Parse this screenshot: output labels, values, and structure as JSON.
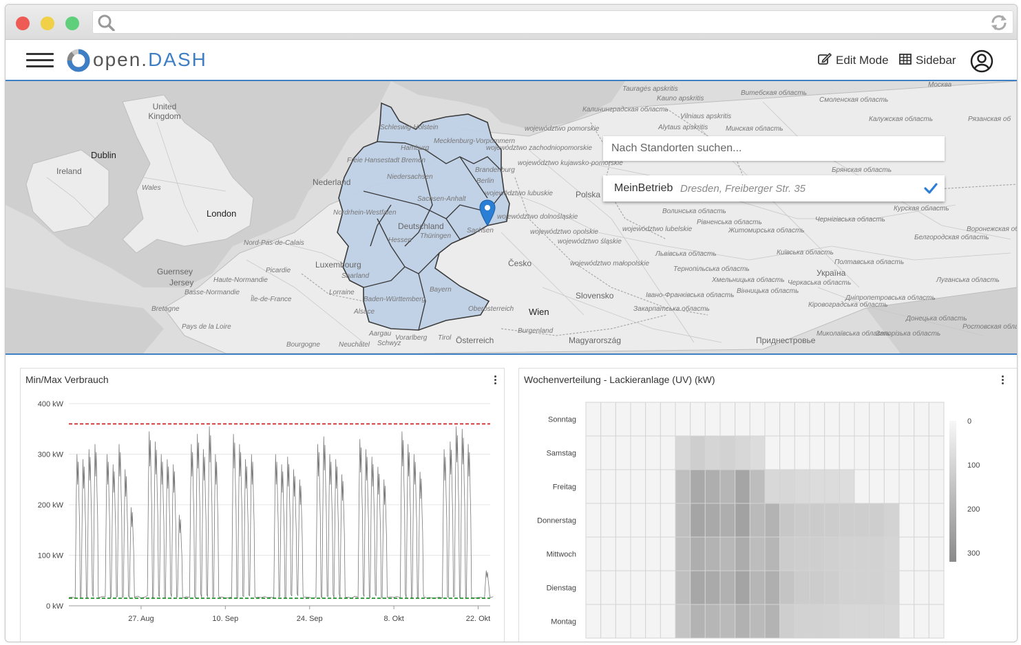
{
  "browser": {
    "search_icon": "search-icon",
    "reload_icon": "reload-icon"
  },
  "app": {
    "logo_text_main": "open.",
    "logo_text_accent": "DASH",
    "menu_icon": "hamburger-menu-icon",
    "edit_mode_label": "Edit Mode",
    "sidebar_label": "Sidebar",
    "user_icon": "user-account-icon",
    "accent_color": "#3d7ec4"
  },
  "map": {
    "search_placeholder": "Nach Standorten suchen...",
    "result": {
      "name": "MeinBetrieb",
      "address": "Dresden, Freiberger Str. 35",
      "selected": true
    },
    "labels": {
      "dublin": "Dublin",
      "ireland": "Ireland",
      "uk": "United Kingdom",
      "wales": "Wales",
      "london": "London",
      "nederland": "Nederland",
      "luxembourg": "Luxembourg",
      "nord_pas": "Nord-Pas-de-Calais",
      "picardie": "Picardie",
      "guernsey": "Guernsey",
      "jersey": "Jersey",
      "haute_normandie": "Haute-Normandie",
      "basse_normandie": "Basse-Normandie",
      "ile_de_france": "Île-de-France",
      "bretagne": "Bretagne",
      "pays_de_la_loire": "Pays de la Loire",
      "lorraine": "Lorraine",
      "alsace": "Alsace",
      "bourgogne": "Bourgogne",
      "neuchatel": "Neuchâtel",
      "schwyz": "Schwyz",
      "aargau": "Aargau",
      "vorarlberg": "Vorarlberg",
      "tirol": "Tirol",
      "oesterreich": "Österreich",
      "oberoesterreich": "Oberösterreich",
      "wien": "Wien",
      "burgenland": "Burgenland",
      "cesko": "Česko",
      "slovensko": "Slovensko",
      "magyarorszag": "Magyarország",
      "polska": "Polska",
      "sh": "Schleswig-Holstein",
      "mv": "Mecklenburg-Vorpommern",
      "hamburg": "Hamburg",
      "bremen": "Freie Hansestadt Bremen",
      "niedersachsen": "Niedersachsen",
      "brandenburg": "Brandenburg",
      "berlin": "Berlin",
      "sachsen_anhalt": "Sachsen-Anhalt",
      "nrw": "Nordrhein-Westfalen",
      "deutschland": "Deutschland",
      "hessen": "Hessen",
      "thueringen": "Thüringen",
      "sachsen": "Sachsen",
      "saarland": "Saarland",
      "bw": "Baden-Württemberg",
      "bayern": "Bayern",
      "pomorskie": "województwo pomorskie",
      "zachodniopomorskie": "województwo zachodniopomorskie",
      "kujawsko": "województwo kujawsko-pomorskie",
      "lubuskie": "województwo lubuskie",
      "dolnoslaskie": "województwo dolnośląskie",
      "opolskie": "województwo opolskie",
      "slaskie": "województwo śląskie",
      "lubelskie": "województwo lubelskie",
      "malopolskie": "województwo małopolskie",
      "kaliningrad": "Калининградская область",
      "taurages": "Tauragės apskritis",
      "kauno": "Kauno apskritis",
      "vilniaus": "Vilniaus apskritis",
      "alytaus": "Alytaus apskritis",
      "vitebsk": "Витебская область",
      "minsk": "Минская область",
      "smolensk": "Смоленская область",
      "kaluga": "Калужская область",
      "moskva": "Москва",
      "bryansk": "Брянская область",
      "kursk": "Курская область",
      "belgorod": "Белгородская область",
      "ukraina": "Україна",
      "volyn": "Волинська область",
      "rivne": "Рівненська область",
      "zhytomyr": "Житомирська область",
      "lviv": "Львівська область",
      "kyiv": "Київська область",
      "chernihiv": "Чернігівська область",
      "poltava": "Полтавська область",
      "ternopil": "Тернопільська область",
      "khmelnytskyi": "Хмельницька область",
      "cherkasy": "Черкаська область",
      "vinnytsia": "Вінницька область",
      "ivano": "Івано-Франківська область",
      "zakarpattia": "Закарпатська область",
      "kirovohrad": "Кіровоградська область",
      "dnipro": "Дніпропетровська область",
      "luhansk": "Луганська область",
      "donetsk": "Донецька область",
      "mykolaiv": "Миколаївська область",
      "zaporizhzhia": "Запорізька область",
      "rostov": "Ростовская область",
      "pridnestrovye": "Приднестровье",
      "ryazan": "Рязанская об",
      "voronezh": "Воронежская об"
    }
  },
  "panels": {
    "left": {
      "title": "Min/Max Verbrauch",
      "menu_icon": "more-vertical-icon"
    },
    "right": {
      "title": "Wochenverteilung - Lackieranlage (UV) (kW)",
      "menu_icon": "more-vertical-icon"
    }
  },
  "chart_data": [
    {
      "type": "line",
      "title": "Min/Max Verbrauch",
      "yticks": [
        "0 kW",
        "100 kW",
        "200 kW",
        "300 kW",
        "400 kW"
      ],
      "ylim": [
        0,
        400
      ],
      "xticks": [
        "27. Aug",
        "10. Sep",
        "24. Sep",
        "8. Okt",
        "22. Okt"
      ],
      "x_range_days": [
        "2017-08-15",
        "2017-10-24"
      ],
      "series_color": "#777777",
      "max_line": {
        "value": 360,
        "color": "#cc1111",
        "style": "dashed"
      },
      "min_line": {
        "value": 15,
        "color": "#118811",
        "style": "dashed"
      },
      "baseline": 15,
      "daily_peaks": [
        {
          "date": "2017-08-16",
          "value": 300
        },
        {
          "date": "2017-08-17",
          "value": 290
        },
        {
          "date": "2017-08-18",
          "value": 310
        },
        {
          "date": "2017-08-19",
          "value": 320
        },
        {
          "date": "2017-08-21",
          "value": 300
        },
        {
          "date": "2017-08-22",
          "value": 280
        },
        {
          "date": "2017-08-23",
          "value": 320
        },
        {
          "date": "2017-08-24",
          "value": 270
        },
        {
          "date": "2017-08-25",
          "value": 195
        },
        {
          "date": "2017-08-28",
          "value": 345
        },
        {
          "date": "2017-08-29",
          "value": 325
        },
        {
          "date": "2017-08-30",
          "value": 300
        },
        {
          "date": "2017-08-31",
          "value": 290
        },
        {
          "date": "2017-09-01",
          "value": 280
        },
        {
          "date": "2017-09-02",
          "value": 180
        },
        {
          "date": "2017-09-04",
          "value": 320
        },
        {
          "date": "2017-09-05",
          "value": 340
        },
        {
          "date": "2017-09-06",
          "value": 310
        },
        {
          "date": "2017-09-07",
          "value": 355
        },
        {
          "date": "2017-09-08",
          "value": 300
        },
        {
          "date": "2017-09-11",
          "value": 340
        },
        {
          "date": "2017-09-12",
          "value": 320
        },
        {
          "date": "2017-09-13",
          "value": 290
        },
        {
          "date": "2017-09-14",
          "value": 300
        },
        {
          "date": "2017-09-18",
          "value": 300
        },
        {
          "date": "2017-09-19",
          "value": 280
        },
        {
          "date": "2017-09-20",
          "value": 295
        },
        {
          "date": "2017-09-21",
          "value": 270
        },
        {
          "date": "2017-09-22",
          "value": 250
        },
        {
          "date": "2017-09-25",
          "value": 320
        },
        {
          "date": "2017-09-26",
          "value": 335
        },
        {
          "date": "2017-09-27",
          "value": 300
        },
        {
          "date": "2017-09-28",
          "value": 290
        },
        {
          "date": "2017-09-29",
          "value": 260
        },
        {
          "date": "2017-10-02",
          "value": 330
        },
        {
          "date": "2017-10-03",
          "value": 310
        },
        {
          "date": "2017-10-04",
          "value": 295
        },
        {
          "date": "2017-10-05",
          "value": 275
        },
        {
          "date": "2017-10-06",
          "value": 250
        },
        {
          "date": "2017-10-09",
          "value": 345
        },
        {
          "date": "2017-10-10",
          "value": 320
        },
        {
          "date": "2017-10-11",
          "value": 300
        },
        {
          "date": "2017-10-12",
          "value": 265
        },
        {
          "date": "2017-10-16",
          "value": 310
        },
        {
          "date": "2017-10-17",
          "value": 325
        },
        {
          "date": "2017-10-18",
          "value": 355
        },
        {
          "date": "2017-10-19",
          "value": 350
        },
        {
          "date": "2017-10-20",
          "value": 320
        },
        {
          "date": "2017-10-23",
          "value": 70
        }
      ]
    },
    {
      "type": "heatmap",
      "title": "Wochenverteilung - Lackieranlage (UV) (kW)",
      "y_categories": [
        "Sonntag",
        "Samstag",
        "Freitag",
        "Donnerstag",
        "Mittwoch",
        "Dienstag",
        "Montag"
      ],
      "x_count": 24,
      "colorbar_ticks": [
        0,
        100,
        200,
        300
      ],
      "color_range": [
        0,
        320
      ],
      "color_low": "#f7f7f7",
      "color_high": "#8a8a8a",
      "values": [
        [
          8,
          8,
          8,
          8,
          8,
          8,
          8,
          8,
          8,
          8,
          8,
          8,
          8,
          8,
          8,
          8,
          8,
          8,
          8,
          8,
          8,
          8,
          8,
          8
        ],
        [
          8,
          8,
          8,
          8,
          8,
          8,
          95,
          120,
          100,
          110,
          95,
          80,
          8,
          8,
          8,
          8,
          8,
          8,
          8,
          8,
          8,
          8,
          8,
          8
        ],
        [
          8,
          8,
          8,
          8,
          8,
          8,
          165,
          230,
          215,
          190,
          240,
          170,
          90,
          95,
          85,
          80,
          80,
          75,
          8,
          8,
          8,
          8,
          8,
          8
        ],
        [
          8,
          8,
          8,
          8,
          8,
          8,
          165,
          240,
          230,
          215,
          250,
          180,
          200,
          140,
          130,
          130,
          125,
          120,
          120,
          120,
          105,
          8,
          8,
          8
        ],
        [
          8,
          8,
          8,
          8,
          8,
          8,
          165,
          215,
          200,
          185,
          220,
          170,
          190,
          125,
          120,
          120,
          115,
          110,
          110,
          110,
          100,
          8,
          8,
          8
        ],
        [
          8,
          8,
          8,
          8,
          8,
          8,
          165,
          235,
          225,
          205,
          245,
          190,
          210,
          150,
          125,
          125,
          120,
          110,
          110,
          110,
          100,
          8,
          8,
          8
        ],
        [
          8,
          8,
          8,
          8,
          8,
          8,
          150,
          200,
          190,
          180,
          205,
          180,
          200,
          120,
          110,
          110,
          105,
          95,
          95,
          95,
          90,
          8,
          8,
          8
        ]
      ]
    }
  ]
}
